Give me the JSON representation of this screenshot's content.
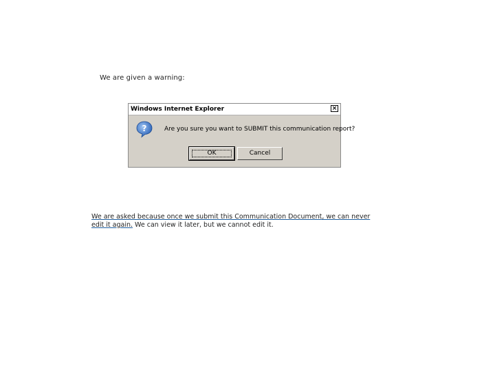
{
  "top_caption": "We are given a warning:",
  "dialog": {
    "title": "Windows Internet Explorer",
    "close_label": "×",
    "icon": "question-icon",
    "message": "Are you sure you want to SUBMIT this communication report?",
    "ok_label": "OK",
    "cancel_label": "Cancel"
  },
  "bottom_caption": {
    "underlined": "We are asked because once we submit this Communication Document, we can never edit it again.",
    "plain": " We can view it later, but we cannot edit it."
  },
  "colors": {
    "dialog_bg": "#d4d0c8",
    "underline": "#1f5fa0",
    "icon_blue": "#2a62b8"
  }
}
